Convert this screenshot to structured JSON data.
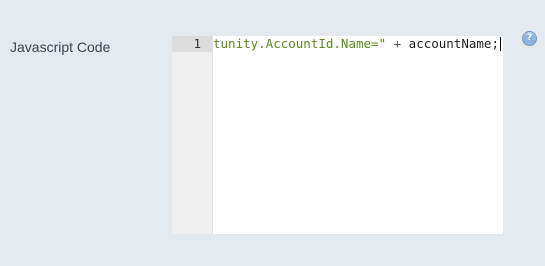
{
  "field": {
    "label": "Javascript Code"
  },
  "editor": {
    "line_number": "1",
    "tokens": {
      "string": "tunity.AccountId.Name=\"",
      "operator": " + ",
      "identifier": "accountName; }"
    }
  },
  "help": {
    "icon": "help-icon",
    "glyph": "?"
  }
}
